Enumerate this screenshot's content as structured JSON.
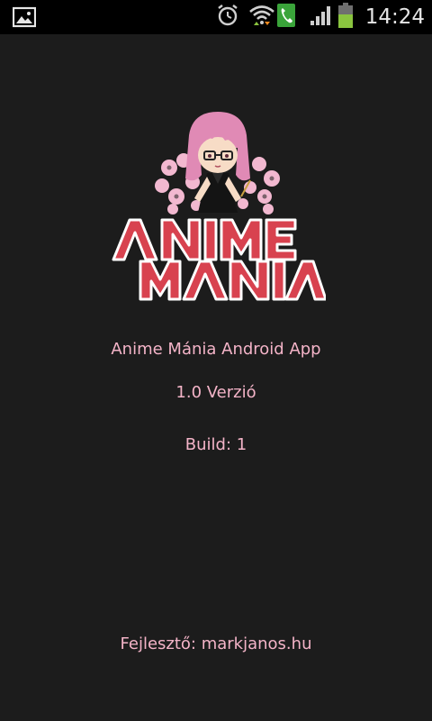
{
  "status_bar": {
    "time": "14:24",
    "icons": [
      "gallery-icon",
      "alarm-icon",
      "wifi-icon",
      "phone-icon",
      "signal-icon",
      "battery-icon"
    ]
  },
  "logo": {
    "wordmark_lines": [
      "ANIME",
      "MANIA"
    ],
    "colors": {
      "wordmark": "#d8424f",
      "blossom": "#f2b8d0",
      "hair": "#e08ab5"
    }
  },
  "about": {
    "app_name": "Anime Mánia Android App",
    "version": "1.0 Verzió",
    "build": "Build: 1",
    "developer": "Fejlesztő: markjanos.hu"
  },
  "colors": {
    "background": "#1c1c1c",
    "text": "#f4b4c8"
  }
}
